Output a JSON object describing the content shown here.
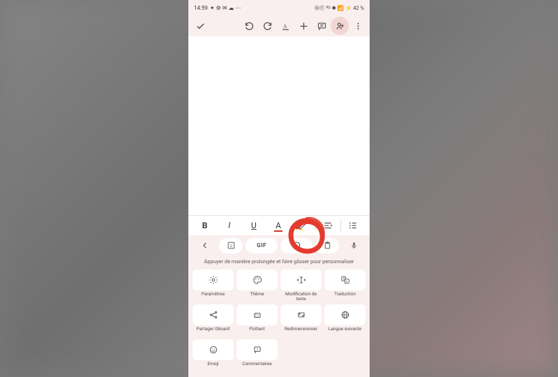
{
  "status": {
    "time": "14:59",
    "icons_left": "✦ ⚙ ✉ ☁ ⋯",
    "icons_right": "ⓃⒻ ⁵ᴳ ✱ 📶 ⚡ 42 %"
  },
  "appbar": {
    "check": "✓",
    "undo": "↶",
    "redo": "↷",
    "textformat": "A",
    "add": "+",
    "comment": "▭",
    "share": "⫟",
    "more": "⋮"
  },
  "format": {
    "bold": "B",
    "italic": "I",
    "underline": "U",
    "textcolor": "A",
    "highlight": "✎",
    "align": "≡",
    "list": "≣"
  },
  "kb": {
    "back": "←",
    "sticker": "☺",
    "gif": "GIF",
    "undo": "↶",
    "clipboard": "📋",
    "mic": "🎤"
  },
  "hint": "Appuyer de manière prolongée et faire glisser pour personnaliser",
  "tiles": [
    {
      "label": "Paramètres",
      "icon": "gear"
    },
    {
      "label": "Thème",
      "icon": "palette"
    },
    {
      "label": "Modification de texte",
      "icon": "textedit"
    },
    {
      "label": "Traduction",
      "icon": "translate"
    },
    {
      "label": "Partager Gboard",
      "icon": "share"
    },
    {
      "label": "Flottant",
      "icon": "float"
    },
    {
      "label": "Redimensionner",
      "icon": "resize"
    },
    {
      "label": "Langue suivante",
      "icon": "globe"
    },
    {
      "label": "Emoji",
      "icon": "emoji"
    },
    {
      "label": "Commentaires",
      "icon": "feedback"
    }
  ]
}
